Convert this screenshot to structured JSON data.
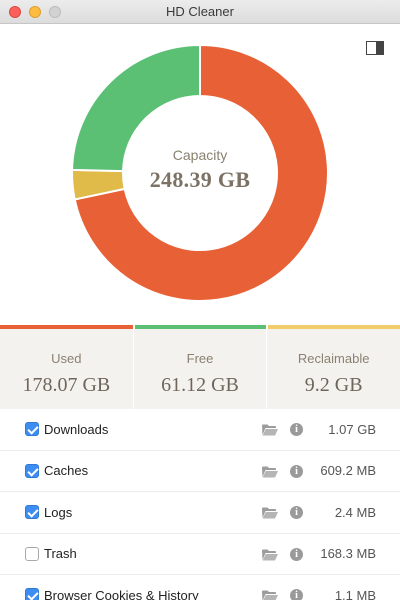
{
  "window": {
    "title": "HD Cleaner"
  },
  "capacity": {
    "label": "Capacity",
    "value": "248.39 GB"
  },
  "disk": {
    "segments": [
      {
        "name": "Used",
        "gb": 178.07,
        "color": "#e86136"
      },
      {
        "name": "Reclaimable",
        "gb": 9.2,
        "color": "#e0bb49"
      },
      {
        "name": "Free",
        "gb": 61.12,
        "color": "#5bbf74"
      }
    ]
  },
  "stats": [
    {
      "label": "Used",
      "value": "178.07 GB",
      "color": "#e86136"
    },
    {
      "label": "Free",
      "value": "61.12 GB",
      "color": "#5bbf74"
    },
    {
      "label": "Reclaimable",
      "value": "9.2 GB",
      "color": "#f0cc6a"
    }
  ],
  "items": [
    {
      "label": "Downloads",
      "size": "1.07 GB",
      "checked": true
    },
    {
      "label": "Caches",
      "size": "609.2 MB",
      "checked": true
    },
    {
      "label": "Logs",
      "size": "2.4 MB",
      "checked": true
    },
    {
      "label": "Trash",
      "size": "168.3 MB",
      "checked": false
    },
    {
      "label": "Browser Cookies & History",
      "size": "1.1 MB",
      "checked": true
    }
  ],
  "icons": {
    "folder": "folder-icon",
    "info": "info-icon",
    "toggle": "sidebar-toggle-icon"
  }
}
